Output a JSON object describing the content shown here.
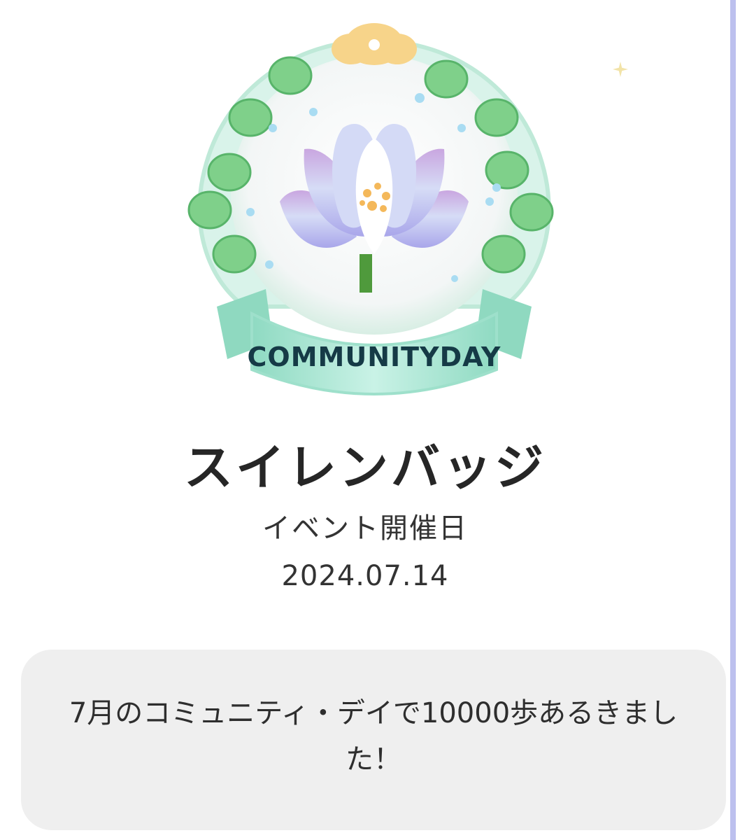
{
  "badge": {
    "emblem_text": "COMMUNITYDAY",
    "title": "スイレンバッジ",
    "subtitle": "イベント開催日",
    "date": "2024.07.14",
    "message": "7月のコミュニティ・デイで10000歩あるきました！"
  },
  "icons": {
    "badge_image": "water-lily-badge-icon",
    "sparkle": "sparkle-icon"
  },
  "colors": {
    "rail": "#bcc0ee",
    "card_bg": "#efefef",
    "leaf_green": "#7fd08a",
    "ribbon": "#a6e6d3",
    "lotus": "#b9b8ee"
  }
}
